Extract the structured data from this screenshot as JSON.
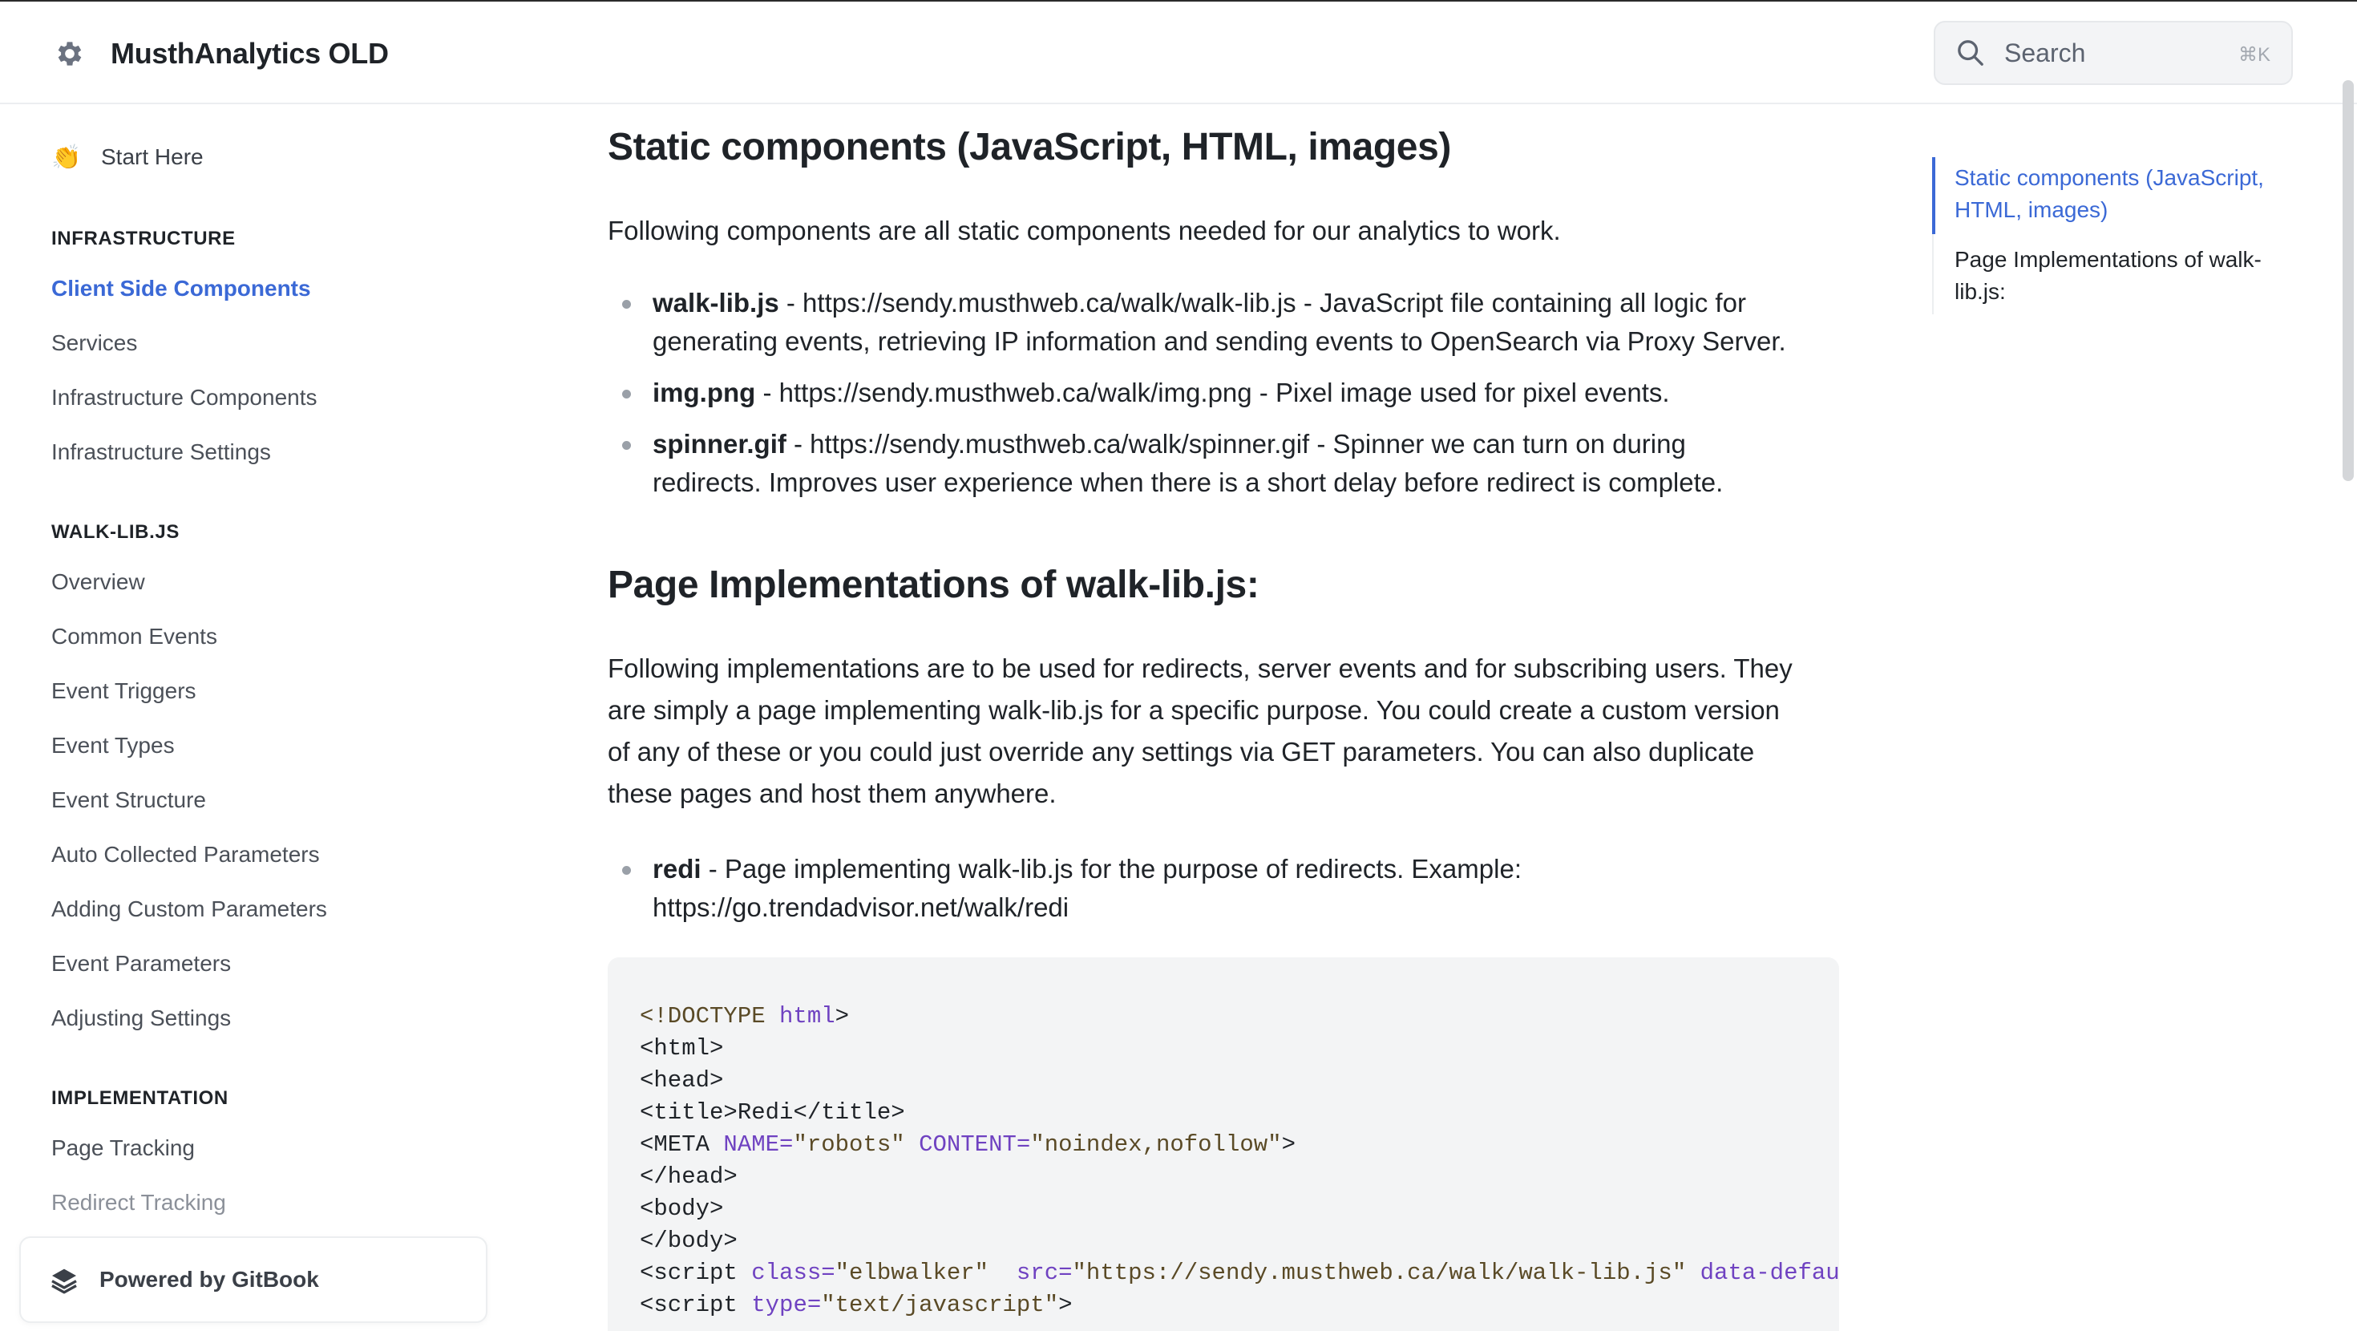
{
  "header": {
    "app_title": "MusthAnalytics OLD",
    "logo_icon": "gear-icon",
    "search": {
      "label": "Search",
      "shortcut": "⌘K"
    }
  },
  "sidebar": {
    "start": {
      "emoji": "👏",
      "label": "Start Here"
    },
    "groups": [
      {
        "title": "INFRASTRUCTURE",
        "items": [
          "Client Side Components",
          "Services",
          "Infrastructure Components",
          "Infrastructure Settings"
        ]
      },
      {
        "title": "WALK-LIB.JS",
        "items": [
          "Overview",
          "Common Events",
          "Event Triggers",
          "Event Types",
          "Event Structure",
          "Auto Collected Parameters",
          "Adding Custom Parameters",
          "Event Parameters",
          "Adjusting Settings"
        ]
      },
      {
        "title": "IMPLEMENTATION",
        "items": [
          "Page Tracking",
          "Redirect Tracking"
        ]
      }
    ],
    "active_item": "Client Side Components",
    "powered_by": "Powered by GitBook"
  },
  "main": {
    "heading1": "Static components (JavaScript, HTML, images)",
    "intro": "Following components are all static components needed for our analytics to work.",
    "static_items": [
      {
        "name": "walk-lib.js",
        "line1": " - https://sendy.musthweb.ca/walk/walk-lib.js - JavaScript file containing all logic for",
        "line2": "generating events, retrieving IP information and sending events to OpenSearch via Proxy Server."
      },
      {
        "name": "img.png",
        "line1": " - https://sendy.musthweb.ca/walk/img.png - Pixel image used for pixel events.",
        "line2": ""
      },
      {
        "name": "spinner.gif",
        "line1": " - https://sendy.musthweb.ca/walk/spinner.gif - Spinner we can turn on during",
        "line2": "redirects. Improves user experience when there is a short delay before redirect is complete."
      }
    ],
    "heading2": "Page Implementations of walk-lib.js:",
    "impl_para": [
      "Following implementations are to be used for redirects, server events and for subscribing users. They",
      "are simply a page implementing walk-lib.js for a specific purpose. You could create a custom version",
      "of any of these or you could just override any settings via GET parameters. You can also duplicate",
      "these pages and host them anywhere."
    ],
    "impl_items": [
      {
        "name": "redi",
        "line1": " - Page implementing walk-lib.js for the purpose of redirects. Example:",
        "line2": "https://go.trendadvisor.net/walk/redi"
      }
    ],
    "code": {
      "l1_tag": "<!DOCTYPE ",
      "l1_attr": "html",
      "l1_end": ">",
      "l2": "<html>",
      "l3": "<head>",
      "l4_open": "<title>",
      "l4_text": "Redi",
      "l4_close": "</title>",
      "l5_tag": "<META ",
      "l5_a1": "NAME=",
      "l5_v1": "\"robots\"",
      "l5_a2": " CONTENT=",
      "l5_v2": "\"noindex,nofollow\"",
      "l5_end": ">",
      "l6": "</head>",
      "l7": "<body>",
      "l8": "</body>",
      "l9_tag": "<script ",
      "l9_a1": "class=",
      "l9_v1": "\"elbwalker\"",
      "l9_a2": "  src=",
      "l9_v2": "\"https://sendy.musthweb.ca/walk/walk-lib.js\"",
      "l9_a3": " data-default=",
      "l10_tag": "<script ",
      "l10_a1": "type=",
      "l10_v1": "\"text/javascript\"",
      "l10_end": ">"
    }
  },
  "toc": {
    "items": [
      "Static components (JavaScript, HTML, images)",
      "Page Implementations of walk-lib.js:"
    ],
    "active_index": 0
  },
  "colors": {
    "accent": "#3b69d6",
    "text": "#1f2328",
    "muted": "#4b5058",
    "code_bg": "#f3f4f5"
  }
}
